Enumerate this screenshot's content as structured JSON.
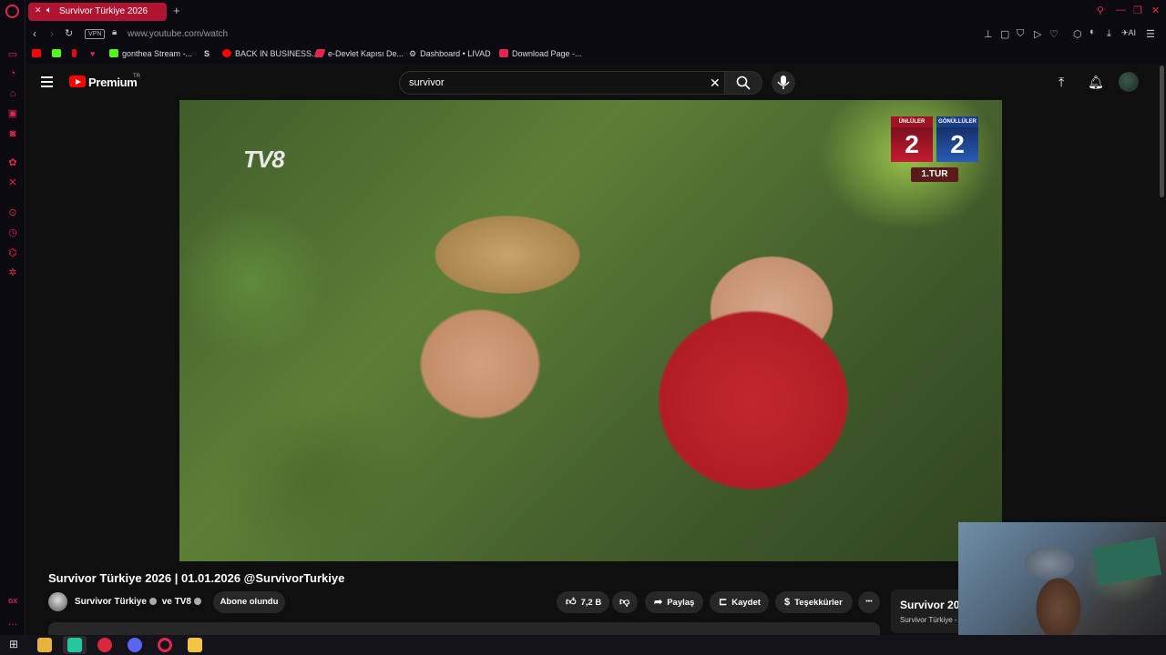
{
  "browser": {
    "tab": {
      "title": "Survivor Türkiye 2026",
      "audio_icon": "speaker-icon"
    },
    "new_tab_label": "+",
    "vpn_label": "VPN",
    "url": "www.youtube.com/watch",
    "ai_label": "AI",
    "bookmarks": [
      {
        "label": "",
        "icon": "youtube-icon",
        "color": "#ff0000"
      },
      {
        "label": "",
        "icon": "kick-icon",
        "color": "#53fc18"
      },
      {
        "label": "",
        "icon": "netflix-icon",
        "color": "#e50914"
      },
      {
        "label": "",
        "icon": "heart-icon",
        "color": "#e3264f"
      },
      {
        "label": "gonthea Stream -...",
        "icon": "kick-icon",
        "color": "#53fc18"
      },
      {
        "label": "",
        "icon": "s-icon",
        "color": "#ffffff"
      },
      {
        "label": "BACK IN BUSINESS...",
        "icon": "youtube-icon",
        "color": "#ff0000"
      },
      {
        "label": "e-Devlet Kapısı De...",
        "icon": "edevlet-icon",
        "color": "#e3264f"
      },
      {
        "label": "Dashboard • LIVAD",
        "icon": "gear-icon",
        "color": "#cccccc"
      },
      {
        "label": "Download Page -...",
        "icon": "download-page-icon",
        "color": "#e3264f"
      }
    ],
    "sidebar_bottom_label": "GX"
  },
  "youtube": {
    "brand": "Premium",
    "region": "TR",
    "search": {
      "value": "survivor"
    },
    "video": {
      "overlay_logo": "TV8",
      "scoreboard": {
        "team_left": "ÜNLÜLER",
        "score_left": "2",
        "team_right": "GÖNÜLLÜLER",
        "score_right": "2",
        "round": "1.TUR"
      },
      "title": "Survivor Türkiye 2026 | 01.01.2026 @SurvivorTurkiye",
      "channel": "Survivor Türkiye",
      "collab": "ve TV8",
      "subscribe_label": "Abone olundu",
      "likes": "7,2 B",
      "share_label": "Paylaş",
      "save_label": "Kaydet",
      "thanks_label": "Teşekkürler",
      "more_label": "•••"
    },
    "related": {
      "title": "Survivor 20",
      "channel": "Survivor Türkiye -"
    }
  },
  "colors": {
    "opera_red": "#e3264f",
    "tab_active": "#b01433",
    "yt_red": "#ff0000"
  }
}
